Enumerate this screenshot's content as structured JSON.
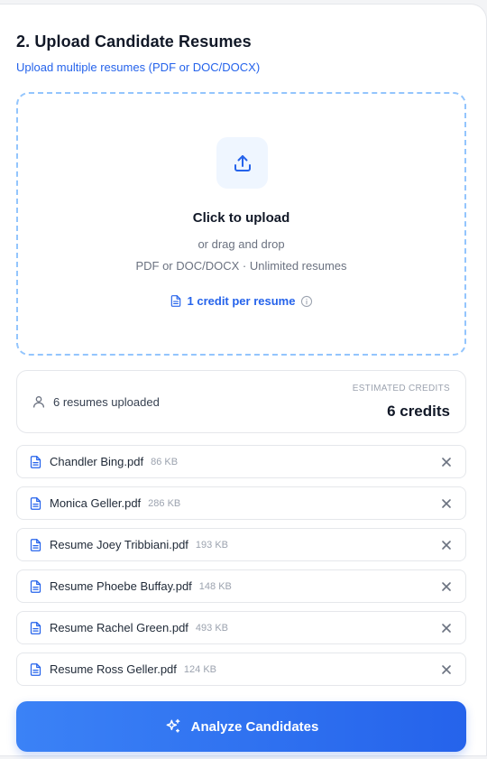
{
  "section": {
    "title": "2. Upload Candidate Resumes",
    "subtitle": "Upload multiple resumes (PDF or DOC/DOCX)"
  },
  "dropzone": {
    "icon": "upload-icon",
    "title": "Click to upload",
    "line1": "or drag and drop",
    "line2": "PDF or DOC/DOCX · Unlimited resumes",
    "credit_note": "1 credit per resume",
    "credit_icon": "document-icon",
    "info_icon": "info-icon"
  },
  "summary": {
    "uploaded_text": "6 resumes uploaded",
    "user_icon": "user-icon",
    "estimated_label": "ESTIMATED CREDITS",
    "estimated_value": "6 credits"
  },
  "files": [
    {
      "name": "Chandler Bing.pdf",
      "size": "86 KB"
    },
    {
      "name": "Monica Geller.pdf",
      "size": "286 KB"
    },
    {
      "name": "Resume Joey Tribbiani.pdf",
      "size": "193 KB"
    },
    {
      "name": "Resume Phoebe Buffay.pdf",
      "size": "148 KB"
    },
    {
      "name": "Resume Rachel Green.pdf",
      "size": "493 KB"
    },
    {
      "name": "Resume Ross Geller.pdf",
      "size": "124 KB"
    }
  ],
  "actions": {
    "analyze_label": "Analyze Candidates",
    "analyze_icon": "sparkles-icon"
  },
  "colors": {
    "accent": "#2563eb",
    "accent_light": "#3b82f6",
    "dropzone_border": "#93c5fd",
    "muted_text": "#6b7280"
  }
}
